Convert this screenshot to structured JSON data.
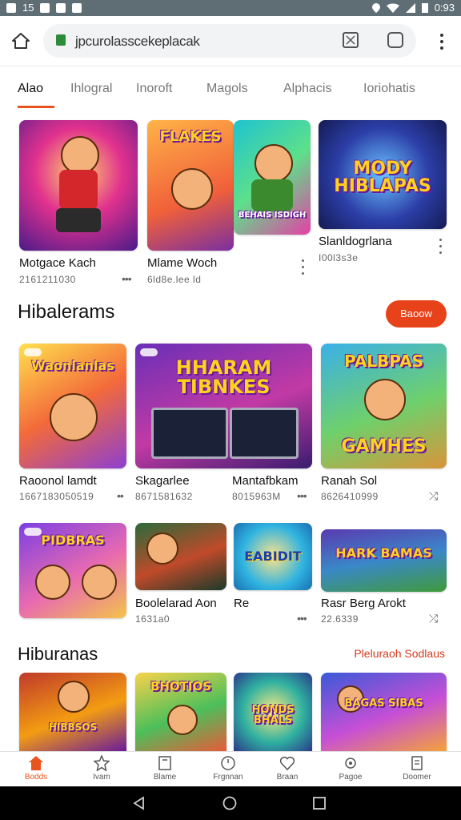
{
  "status": {
    "left_text": "15",
    "time": "0:93"
  },
  "browser": {
    "url": "jpcurolasscekeplacak"
  },
  "tabs": [
    "Alao",
    "Ihlogral",
    "Inoroft",
    "Magols",
    "Alphacis",
    "Ioriohatis"
  ],
  "row1": [
    {
      "title": "Motgace Kach",
      "sub": "2161211030",
      "art": ""
    },
    {
      "title": "Mlame Woch",
      "sub": "6ld8e.lee ld",
      "art": "FLAKES",
      "art2": "BEHAIS ISDIGH"
    },
    {
      "title": "Slanldogrlana",
      "sub": "I00l3s3e",
      "art": "MODY HIBLAPAS"
    }
  ],
  "section1": {
    "title": "Hibalerams",
    "button": "Baoow"
  },
  "row2": [
    {
      "title": "Raoonol lamdt",
      "sub": "1667183050519",
      "art": "Waonlanlas"
    },
    {
      "title": "Skagarlee",
      "sub": "8671581632",
      "art": "HHARAM TIBNKES"
    },
    {
      "title": "Mantafbkam",
      "sub": "8015963M",
      "art": "GAMHES",
      "art_top": "PALBPAS"
    },
    {
      "title": "Ranah Sol",
      "sub": "8626410999",
      "art": ""
    }
  ],
  "row3": [
    {
      "title": "",
      "sub": "",
      "art": "PIDBRAS"
    },
    {
      "title": "Boolelarad Aon",
      "sub": "1631a0",
      "art": ""
    },
    {
      "title": "Re",
      "sub": "",
      "art": "EABIDIT"
    },
    {
      "title": "Rasr Berg Arokt",
      "sub": "22.6339",
      "art": "HARK BAMAS"
    }
  ],
  "section2": {
    "title": "Hiburanas",
    "link": "Pleluraoh Sodlaus"
  },
  "row4": [
    {
      "art": "HIBBSOS"
    },
    {
      "art": "BHOTIOS"
    },
    {
      "art": "HONDS BHALS"
    },
    {
      "art": "BAGAS SIBAS"
    }
  ],
  "nav": [
    {
      "label": "Bodds",
      "icon": "home-icon"
    },
    {
      "label": "Ivam",
      "icon": "star-icon"
    },
    {
      "label": "Blame",
      "icon": "page-icon"
    },
    {
      "label": "Frgnnan",
      "icon": "clock-icon"
    },
    {
      "label": "Braan",
      "icon": "heart-icon"
    },
    {
      "label": "Pagoe",
      "icon": "gear-icon"
    },
    {
      "label": "Doomer",
      "icon": "document-icon"
    }
  ],
  "colors": {
    "accent": "#e8541e",
    "button": "#e8421b",
    "status_bg": "#5f6d74"
  }
}
